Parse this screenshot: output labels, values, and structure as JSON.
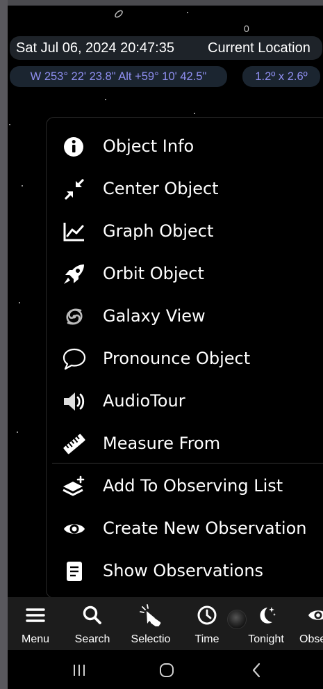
{
  "status": {
    "datetime": "Sat Jul 06, 2024  20:47:35",
    "location": "Current Location"
  },
  "coords": {
    "position": "W 253° 22' 23.8\" Alt +59° 10' 42.5\"",
    "field_of_view": "1.2º x  2.6º"
  },
  "menu": {
    "items": [
      {
        "label": "Object Info",
        "icon": "info-icon"
      },
      {
        "label": "Center Object",
        "icon": "center-arrows-icon"
      },
      {
        "label": "Graph Object",
        "icon": "line-graph-icon"
      },
      {
        "label": "Orbit Object",
        "icon": "rocket-icon"
      },
      {
        "label": "Galaxy View",
        "icon": "galaxy-icon"
      },
      {
        "label": "Pronounce Object",
        "icon": "speech-bubble-icon"
      },
      {
        "label": "AudioTour",
        "icon": "speaker-icon"
      },
      {
        "label": "Measure From",
        "icon": "ruler-icon"
      },
      {
        "label": "Add To Observing List",
        "icon": "layers-add-icon"
      },
      {
        "label": "Create New Observation",
        "icon": "eye-icon"
      },
      {
        "label": "Show Observations",
        "icon": "document-icon"
      }
    ]
  },
  "toolbar": {
    "items": [
      {
        "label": "Menu",
        "icon": "hamburger-icon"
      },
      {
        "label": "Search",
        "icon": "search-icon"
      },
      {
        "label": "Selectio",
        "icon": "pointer-hand-icon"
      },
      {
        "label": "Time",
        "icon": "clock-icon"
      },
      {
        "label": "Tonight",
        "icon": "moon-stars-icon"
      },
      {
        "label": "Obse",
        "icon": "eye-icon"
      }
    ]
  },
  "sky": {
    "labels": [
      "0"
    ]
  },
  "colors": {
    "coord_text": "#8f8ff0",
    "status_bar_bg": "#1e2329",
    "toolbar_bg": "#1c1c1c",
    "menu_bg": "#000000"
  }
}
